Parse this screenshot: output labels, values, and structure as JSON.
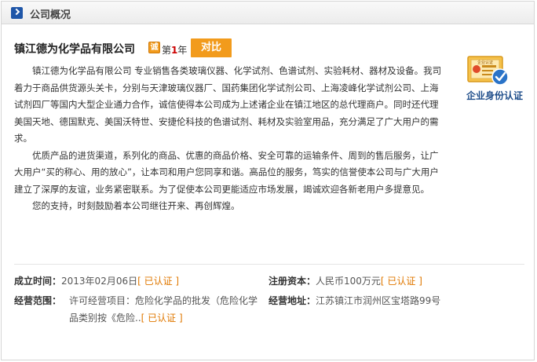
{
  "header": {
    "title": "公司概况"
  },
  "company": {
    "name": "镇江德为化学品有限公司",
    "cheng_badge": "诚",
    "year_prefix": "第",
    "year_num": "1",
    "year_suffix": "年",
    "compare_label": "对比"
  },
  "description": {
    "paragraphs": [
      "镇江德为化学品有限公司 专业销售各类玻璃仪器、化学试剂、色谱试剂、实验耗材、器材及设备。我司着力于商品供货源头关卡，分别与天津玻璃仪器厂、国药集团化学试剂公司、上海凌峰化学试剂公司、上海试剂四厂等国内大型企业通力合作，诚信使得本公司成为上述诸企业在镇江地区的总代理商户。同时还代理美国天地、德国默克、美国沃特世、安捷伦科技的色谱试剂、耗材及实验室用品，充分满足了广大用户的需求。",
      "优质产品的进货渠道，系列化的商品、优惠的商品价格、安全可靠的运输条件、周到的售后服务，让广大用户“买的称心、用的放心”，让本司和用户您同享和谐。高品位的服务，笃实的信誉使本公司与广大用户建立了深厚的友谊，业务紧密联系。为了促使本公司更能适应市场发展，竭诚欢迎各新老用户多提意见。",
      "您的支持，时刻鼓励着本公司继往开来、再创辉煌。"
    ]
  },
  "certification": {
    "label": "企业身份认证",
    "badge_text": "企业认证"
  },
  "info": {
    "founded_label": "成立时间：",
    "founded_value": "2013年02月06日",
    "founded_verified": "[ 已认证 ]",
    "capital_label": "注册资本：",
    "capital_value": "人民币100万元",
    "capital_verified": "[ 已认证 ]",
    "scope_label": "经营范围：",
    "scope_value": "许可经营项目：危险化学品的批发（危险化学品类别按《危险..",
    "scope_verified": "[ 已认证 ]",
    "address_label": "经营地址：",
    "address_value": "江苏镇江市润州区宝塔路99号"
  },
  "colors": {
    "accent_orange": "#f29b1c",
    "header_icon_blue": "#1f56a8",
    "verified_orange": "#e07800",
    "cert_label_blue": "#1e4d8a"
  }
}
